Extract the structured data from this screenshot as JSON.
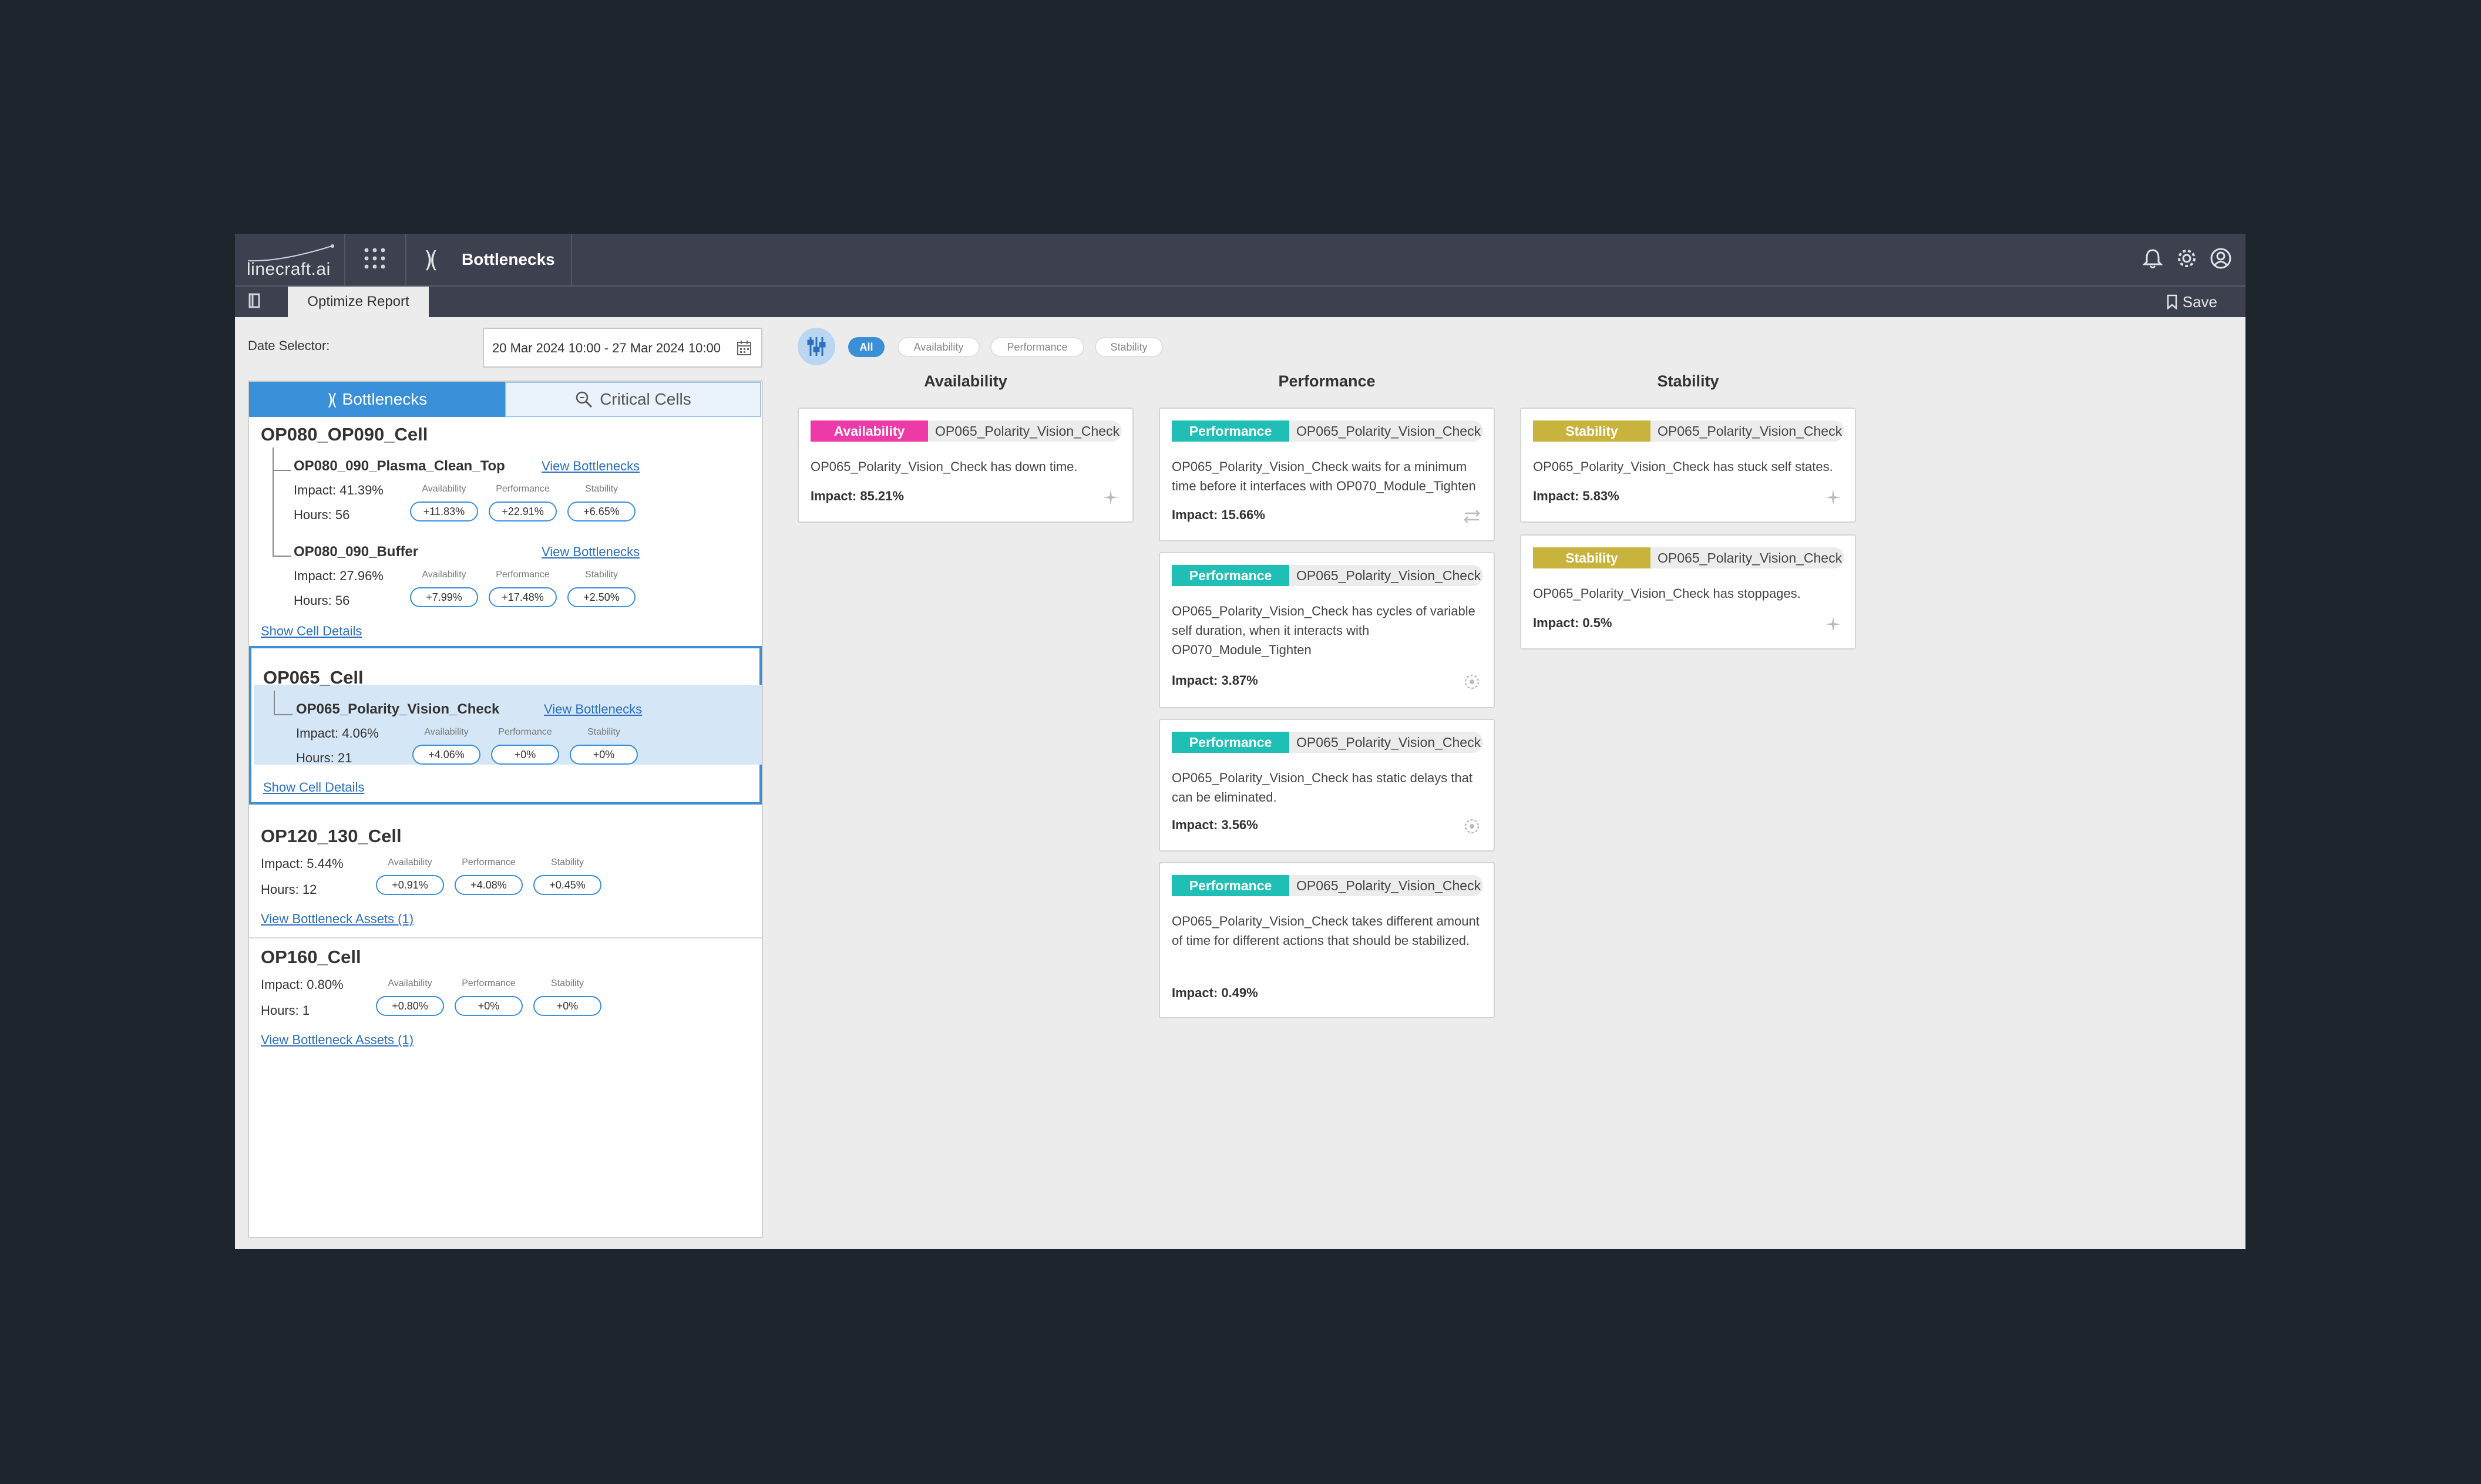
{
  "app": {
    "logo": "linecraft.ai",
    "module_title": "Bottlenecks",
    "tab_label": "Optimize Report",
    "save_label": "Save"
  },
  "date_selector": {
    "label": "Date Selector:",
    "value": "20 Mar 2024 10:00 - 27 Mar 2024 10:00"
  },
  "panel_tabs": {
    "bottlenecks": "Bottlenecks",
    "critical_cells": "Critical Cells"
  },
  "metric_labels": {
    "availability": "Availability",
    "performance": "Performance",
    "stability": "Stability"
  },
  "cells": [
    {
      "title": "OP080_OP090_Cell",
      "assets": [
        {
          "name": "OP080_090_Plasma_Clean_Top",
          "link": "View Bottlenecks",
          "impact": "Impact: 41.39%",
          "hours": "Hours: 56",
          "availability": "+11.83%",
          "performance": "+22.91%",
          "stability": "+6.65%"
        },
        {
          "name": "OP080_090_Buffer",
          "link": "View Bottlenecks",
          "impact": "Impact: 27.96%",
          "hours": "Hours: 56",
          "availability": "+7.99%",
          "performance": "+17.48%",
          "stability": "+2.50%"
        }
      ],
      "footer_link": "Show Cell Details"
    },
    {
      "title": "OP065_Cell",
      "assets": [
        {
          "name": "OP065_Polarity_Vision_Check",
          "link": "View Bottlenecks",
          "impact": "Impact: 4.06%",
          "hours": "Hours: 21",
          "availability": "+4.06%",
          "performance": "+0%",
          "stability": "+0%"
        }
      ],
      "footer_link": "Show Cell Details"
    },
    {
      "title": "OP120_130_Cell",
      "impact": "Impact: 5.44%",
      "hours": "Hours: 12",
      "availability": "+0.91%",
      "performance": "+4.08%",
      "stability": "+0.45%",
      "footer_link": "View Bottleneck Assets (1)"
    },
    {
      "title": "OP160_Cell",
      "impact": "Impact: 0.80%",
      "hours": "Hours: 1",
      "availability": "+0.80%",
      "performance": "+0%",
      "stability": "+0%",
      "footer_link": "View Bottleneck Assets (1)"
    }
  ],
  "filters": {
    "all": "All",
    "availability": "Availability",
    "performance": "Performance",
    "stability": "Stability"
  },
  "columns": {
    "availability": {
      "title": "Availability",
      "cards": [
        {
          "tag": "Availability",
          "asset": "OP065_Polarity_Vision_Check",
          "description": "OP065_Polarity_Vision_Check has down time.",
          "impact": "Impact: 85.21%",
          "icon": "sparkle-icon"
        }
      ]
    },
    "performance": {
      "title": "Performance",
      "cards": [
        {
          "tag": "Performance",
          "asset": "OP065_Polarity_Vision_Check",
          "description": "OP065_Polarity_Vision_Check waits for a minimum time before it interfaces with OP070_Module_Tighten",
          "impact": "Impact: 15.66%",
          "icon": "swap-icon"
        },
        {
          "tag": "Performance",
          "asset": "OP065_Polarity_Vision_Check",
          "description": "OP065_Polarity_Vision_Check has cycles of variable self duration, when it interacts with OP070_Module_Tighten",
          "impact": "Impact: 3.87%",
          "icon": "target-icon"
        },
        {
          "tag": "Performance",
          "asset": "OP065_Polarity_Vision_Check",
          "description": "OP065_Polarity_Vision_Check has static delays that can be eliminated.",
          "impact": "Impact: 3.56%",
          "icon": "target-icon"
        },
        {
          "tag": "Performance",
          "asset": "OP065_Polarity_Vision_Check",
          "description": "OP065_Polarity_Vision_Check takes different amount of time for different actions that should be stabilized.",
          "impact": "Impact: 0.49%",
          "icon": "none"
        }
      ]
    },
    "stability": {
      "title": "Stability",
      "cards": [
        {
          "tag": "Stability",
          "asset": "OP065_Polarity_Vision_Check",
          "description": "OP065_Polarity_Vision_Check has stuck self states.",
          "impact": "Impact: 5.83%",
          "icon": "sparkle-icon"
        },
        {
          "tag": "Stability",
          "asset": "OP065_Polarity_Vision_Check",
          "description": "OP065_Polarity_Vision_Check has stoppages.",
          "impact": "Impact: 0.5%",
          "icon": "sparkle-icon"
        }
      ]
    }
  },
  "colors": {
    "availability": "#ee3aa7",
    "performance": "#1fbfb6",
    "stability": "#c8b43d",
    "accent": "#3a8fd9",
    "topbar": "#3c404f"
  }
}
